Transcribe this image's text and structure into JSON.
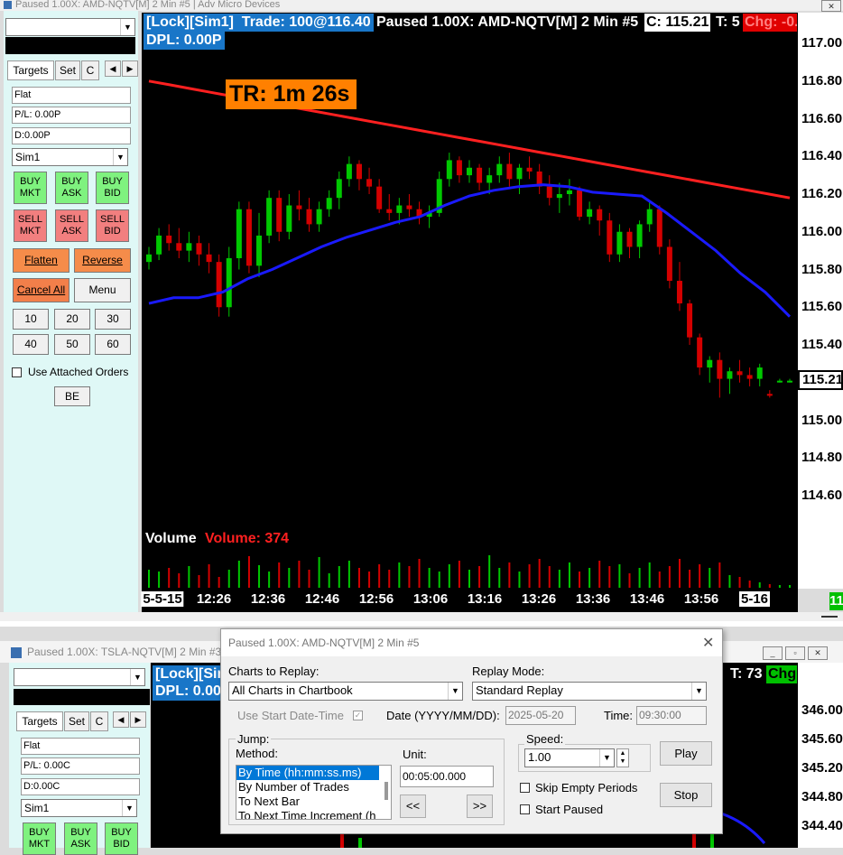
{
  "top_window": {
    "title": "Paused 1.00X: AMD-NQTV[M]  2 Min  #5 | Adv Micro Devices"
  },
  "trade_panel": {
    "tabs": [
      "Targets",
      "Set",
      "C"
    ],
    "position": "Flat",
    "pl": "P/L: 0.00P",
    "daily": "D:0.00P",
    "account": "Sim1",
    "buy_mkt": "BUY\nMKT",
    "buy_ask": "BUY\nASK",
    "buy_bid": "BUY\nBID",
    "sell_mkt": "SELL\nMKT",
    "sell_ask": "SELL\nASK",
    "sell_bid": "SELL\nBID",
    "flatten": "Flatten",
    "reverse": "Reverse",
    "cancel_all": "Cancel All",
    "menu": "Menu",
    "qty": [
      "10",
      "20",
      "30",
      "40",
      "50",
      "60"
    ],
    "use_attached": "Use Attached Orders",
    "be": "BE"
  },
  "chart_header": {
    "lock": "[Lock][Sim1]",
    "trade": "Trade: 100@116.40",
    "paused": "Paused 1.00X: AMD-NQTV[M]  2 Min  #5",
    "close": "C: 115.21",
    "trades": "T: 5",
    "change": "Chg: -0.",
    "dpl": "DPL: 0.00P",
    "tr": "TR: 1m 26s",
    "volume_label": "Volume",
    "volume_value": "Volume: 374",
    "last_price": "115.21",
    "corner": "11",
    "colors": {
      "up": "#00c800",
      "down": "#d40000",
      "ma_red": "#ff2020",
      "ma_blue": "#1a1aff",
      "orange": "#ff8000"
    }
  },
  "chart_data": {
    "type": "candlestick",
    "ylim": [
      114.4,
      117.1
    ],
    "y_ticks": [
      "117.00",
      "116.80",
      "116.60",
      "116.40",
      "116.20",
      "116.00",
      "115.80",
      "115.60",
      "115.40",
      "115.20",
      "115.00",
      "114.80",
      "114.60"
    ],
    "x_ticks": [
      "5-5-15",
      "12:26",
      "12:36",
      "12:46",
      "12:56",
      "13:06",
      "13:16",
      "13:26",
      "13:36",
      "13:46",
      "13:56",
      "5-16"
    ],
    "candles": [
      [
        115.84,
        115.92,
        115.8,
        115.88
      ],
      [
        115.88,
        116.02,
        115.85,
        115.98
      ],
      [
        115.98,
        116.04,
        115.9,
        115.94
      ],
      [
        115.94,
        116.02,
        115.86,
        115.9
      ],
      [
        115.9,
        116.0,
        115.84,
        115.94
      ],
      [
        115.94,
        115.98,
        115.82,
        115.88
      ],
      [
        115.88,
        115.94,
        115.78,
        115.84
      ],
      [
        115.84,
        115.88,
        115.55,
        115.6
      ],
      [
        115.6,
        115.92,
        115.55,
        115.86
      ],
      [
        115.86,
        116.16,
        115.8,
        116.12
      ],
      [
        116.12,
        116.16,
        115.78,
        115.82
      ],
      [
        115.82,
        116.1,
        115.76,
        115.98
      ],
      [
        115.98,
        116.22,
        115.94,
        116.18
      ],
      [
        116.18,
        116.22,
        115.95,
        116.0
      ],
      [
        116.0,
        116.2,
        115.96,
        116.14
      ],
      [
        116.14,
        116.22,
        116.06,
        116.12
      ],
      [
        116.12,
        116.18,
        116.0,
        116.04
      ],
      [
        116.04,
        116.16,
        116.0,
        116.12
      ],
      [
        116.12,
        116.22,
        116.08,
        116.18
      ],
      [
        116.18,
        116.32,
        116.12,
        116.28
      ],
      [
        116.28,
        116.4,
        116.24,
        116.36
      ],
      [
        116.36,
        116.38,
        116.22,
        116.28
      ],
      [
        116.28,
        116.34,
        116.2,
        116.24
      ],
      [
        116.24,
        116.28,
        116.1,
        116.12
      ],
      [
        116.12,
        116.2,
        116.06,
        116.1
      ],
      [
        116.1,
        116.18,
        116.04,
        116.14
      ],
      [
        116.14,
        116.2,
        116.08,
        116.12
      ],
      [
        116.12,
        116.16,
        116.04,
        116.08
      ],
      [
        116.08,
        116.14,
        116.02,
        116.1
      ],
      [
        116.1,
        116.32,
        116.08,
        116.28
      ],
      [
        116.28,
        116.42,
        116.24,
        116.38
      ],
      [
        116.38,
        116.4,
        116.26,
        116.3
      ],
      [
        116.3,
        116.38,
        116.26,
        116.34
      ],
      [
        116.34,
        116.36,
        116.22,
        116.26
      ],
      [
        116.26,
        116.34,
        116.2,
        116.3
      ],
      [
        116.3,
        116.4,
        116.26,
        116.36
      ],
      [
        116.36,
        116.42,
        116.24,
        116.28
      ],
      [
        116.28,
        116.36,
        116.2,
        116.34
      ],
      [
        116.34,
        116.4,
        116.28,
        116.32
      ],
      [
        116.32,
        116.36,
        116.2,
        116.24
      ],
      [
        116.24,
        116.3,
        116.14,
        116.18
      ],
      [
        116.18,
        116.26,
        116.1,
        116.2
      ],
      [
        116.2,
        116.28,
        116.14,
        116.22
      ],
      [
        116.22,
        116.24,
        116.06,
        116.08
      ],
      [
        116.08,
        116.16,
        116.04,
        116.12
      ],
      [
        116.12,
        116.14,
        115.98,
        116.06
      ],
      [
        116.06,
        116.1,
        115.84,
        115.88
      ],
      [
        115.88,
        116.04,
        115.84,
        116.0
      ],
      [
        116.0,
        116.02,
        115.86,
        115.92
      ],
      [
        115.92,
        116.06,
        115.86,
        116.04
      ],
      [
        116.04,
        116.16,
        116.0,
        116.12
      ],
      [
        116.12,
        116.14,
        115.88,
        115.92
      ],
      [
        115.92,
        115.96,
        115.7,
        115.74
      ],
      [
        115.74,
        115.84,
        115.58,
        115.62
      ],
      [
        115.62,
        115.64,
        115.4,
        115.44
      ],
      [
        115.44,
        115.46,
        115.24,
        115.28
      ],
      [
        115.28,
        115.34,
        115.2,
        115.32
      ],
      [
        115.32,
        115.36,
        115.12,
        115.22
      ],
      [
        115.22,
        115.28,
        115.14,
        115.26
      ],
      [
        115.26,
        115.32,
        115.2,
        115.24
      ],
      [
        115.24,
        115.28,
        115.18,
        115.22
      ],
      [
        115.22,
        115.3,
        115.18,
        115.28
      ],
      [
        115.14,
        115.16,
        115.12,
        115.13
      ],
      [
        115.21,
        115.22,
        115.2,
        115.21
      ],
      [
        115.21,
        115.22,
        115.2,
        115.21
      ]
    ],
    "ma_red": [
      116.8,
      116.78,
      116.76,
      116.74,
      116.72,
      116.7,
      116.68,
      116.66,
      116.64,
      116.62,
      116.6,
      116.58,
      116.56,
      116.54,
      116.52,
      116.5,
      116.48,
      116.46,
      116.44,
      116.42,
      116.4,
      116.38,
      116.36,
      116.34,
      116.32,
      116.3,
      116.28,
      116.26,
      116.24,
      116.22,
      116.2,
      116.18
    ],
    "ma_blue": [
      115.62,
      115.65,
      115.65,
      115.68,
      115.75,
      115.8,
      115.86,
      115.92,
      115.97,
      116.01,
      116.05,
      116.08,
      116.14,
      116.19,
      116.22,
      116.24,
      116.25,
      116.24,
      116.21,
      116.2,
      116.19,
      116.1,
      116.0,
      115.9,
      115.78,
      115.68,
      115.55
    ],
    "volume": [
      20,
      18,
      22,
      16,
      24,
      14,
      26,
      12,
      20,
      30,
      35,
      25,
      18,
      28,
      22,
      30,
      20,
      34,
      16,
      24,
      30,
      22,
      18,
      26,
      20,
      28,
      24,
      32,
      22,
      18,
      26,
      30,
      20,
      24,
      36,
      22,
      28,
      18,
      26,
      32,
      24,
      20,
      28,
      18,
      22,
      30,
      24,
      26,
      16,
      22,
      28,
      18,
      24,
      32,
      20,
      26,
      22,
      28,
      14,
      12,
      8,
      6,
      4,
      3,
      3
    ]
  },
  "bottom_window": {
    "title": "Paused 1.00X: TSLA-NQTV[M]  2 Min  #3",
    "tabs": [
      "Targets",
      "Set",
      "C"
    ],
    "position": "Flat",
    "pl": "P/L: 0.00C",
    "daily": "D:0.00C",
    "account": "Sim1",
    "buy_mkt": "BUY\nMKT",
    "buy_ask": "BUY\nASK",
    "buy_bid": "BUY\nBID",
    "lock": "[Lock][Sim",
    "dpl": "DPL: 0.00",
    "trades": "T: 73",
    "change": "Chg",
    "y_ticks": [
      "346.00",
      "345.60",
      "345.20",
      "344.80",
      "344.40"
    ]
  },
  "replay_dialog": {
    "title": "Paused 1.00X: AMD-NQTV[M]  2 Min  #5",
    "charts_to_replay_label": "Charts to Replay:",
    "charts_to_replay_value": "All Charts in Chartbook",
    "replay_mode_label": "Replay Mode:",
    "replay_mode_value": "Standard Replay",
    "use_start": "Use Start Date-Time",
    "date_label": "Date (YYYY/MM/DD):",
    "date_value": "2025-05-20",
    "time_label": "Time:",
    "time_value": "09:30:00",
    "jump_label": "Jump:",
    "method_label": "Method:",
    "methods": [
      "By Time (hh:mm:ss.ms)",
      "By Number of Trades",
      "To Next Bar",
      "To Next Time Increment (h"
    ],
    "unit_label": "Unit:",
    "unit_value": "00:05:00.000",
    "back": "<<",
    "fwd": ">>",
    "speed_label": "Speed:",
    "speed_value": "1.00",
    "play": "Play",
    "skip_empty": "Skip Empty Periods",
    "start_paused": "Start Paused",
    "stop": "Stop"
  }
}
